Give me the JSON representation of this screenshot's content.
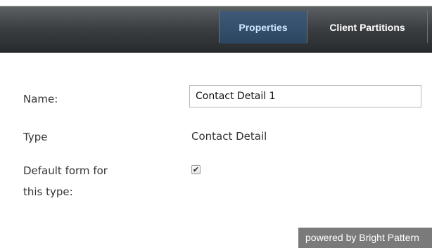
{
  "tabs": [
    {
      "label": "Properties",
      "active": true
    },
    {
      "label": "Client Partitions",
      "active": false
    }
  ],
  "form": {
    "name_label": "Name:",
    "name_value": "Contact Detail 1",
    "type_label": "Type",
    "type_value": "Contact Detail",
    "default_label_line1": "Default form for",
    "default_label_line2": "this type:",
    "default_checked": true,
    "check_glyph": "✔"
  },
  "footer": {
    "powered_text": "powered by Bright Pattern"
  },
  "colors": {
    "active_tab": "#34506c",
    "bar_dark": "#2a2d2f",
    "footer_bg": "#7a7a7a"
  }
}
